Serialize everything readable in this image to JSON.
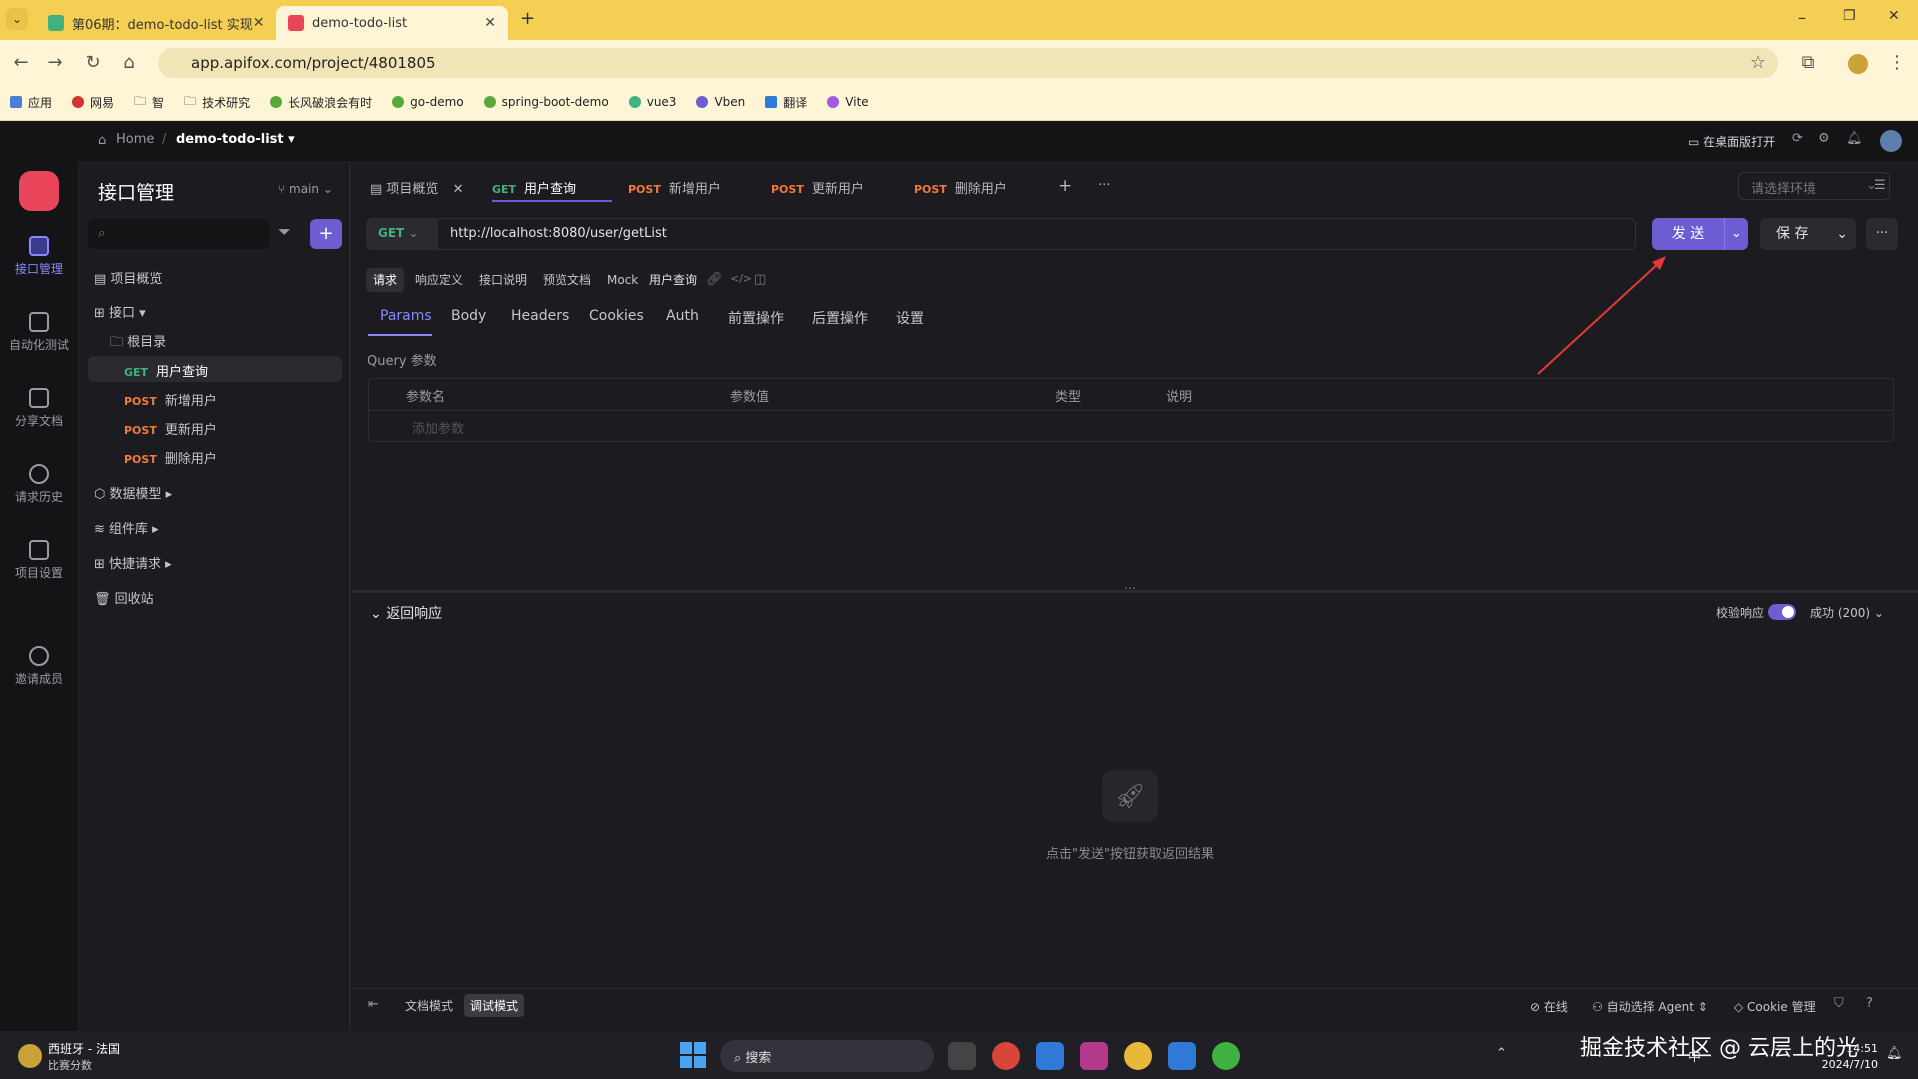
{
  "browser": {
    "tabs": [
      {
        "title": "第06期：demo-todo-list 实现",
        "active": false
      },
      {
        "title": "demo-todo-list",
        "active": true
      }
    ],
    "url": "app.apifox.com/project/4801805",
    "bookmarks": [
      "应用",
      "网易",
      "智",
      "技术研究",
      "长风破浪会有时",
      "go-demo",
      "spring-boot-demo",
      "vue3",
      "Vben",
      "翻译",
      "Vite"
    ]
  },
  "header": {
    "breadcrumb_home": "Home",
    "breadcrumb_sep": "/",
    "project": "demo-todo-list ▾",
    "open_desktop": "在桌面版打开"
  },
  "leftnav": {
    "items": [
      "接口管理",
      "自动化测试",
      "分享文档",
      "请求历史",
      "项目设置",
      "邀请成员"
    ]
  },
  "sidebar": {
    "title": "接口管理",
    "branch": "main",
    "overview": "项目概览",
    "interfaces": "接口",
    "root": "根目录",
    "apis": [
      {
        "method": "GET",
        "name": "用户查询"
      },
      {
        "method": "POST",
        "name": "新增用户"
      },
      {
        "method": "POST",
        "name": "更新用户"
      },
      {
        "method": "POST",
        "name": "删除用户"
      }
    ],
    "models": "数据模型",
    "components": "组件库",
    "quick": "快捷请求",
    "trash": "回收站"
  },
  "tabs": [
    {
      "method": "",
      "name": "项目概览"
    },
    {
      "method": "GET",
      "name": "用户查询"
    },
    {
      "method": "POST",
      "name": "新增用户"
    },
    {
      "method": "POST",
      "name": "更新用户"
    },
    {
      "method": "POST",
      "name": "删除用户"
    }
  ],
  "env_placeholder": "请选择环境",
  "request": {
    "method": "GET",
    "url": "http://localhost:8080/user/getList",
    "send": "发 送",
    "save": "保 存"
  },
  "mode_pills": [
    "请求",
    "响应定义",
    "接口说明",
    "预览文档",
    "Mock"
  ],
  "api_name": "用户查询",
  "subtabs": [
    "Params",
    "Body",
    "Headers",
    "Cookies",
    "Auth",
    "前置操作",
    "后置操作",
    "设置"
  ],
  "query_title": "Query 参数",
  "table_headers": [
    "参数名",
    "参数值",
    "类型",
    "说明"
  ],
  "add_param": "添加参数",
  "response": {
    "title": "返回响应",
    "validate": "校验响应",
    "status": "成功 (200)",
    "hint": "点击\"发送\"按钮获取返回结果"
  },
  "footer": {
    "doc_mode": "文档模式",
    "debug_mode": "调试模式",
    "online": "在线",
    "agent": "自动选择 Agent",
    "cookie": "Cookie 管理"
  },
  "taskbar": {
    "weather_title": "西班牙 - 法国",
    "weather_sub": "比赛分数",
    "search": "搜索",
    "ime": "中",
    "time": "14:51",
    "date": "2024/7/10",
    "watermark": "掘金技术社区 @ 云层上的光"
  },
  "colors": {
    "accent": "#6d5dd3",
    "get": "#3fb27f",
    "post": "#f07a3a",
    "browser_bar": "#f5cf53"
  }
}
